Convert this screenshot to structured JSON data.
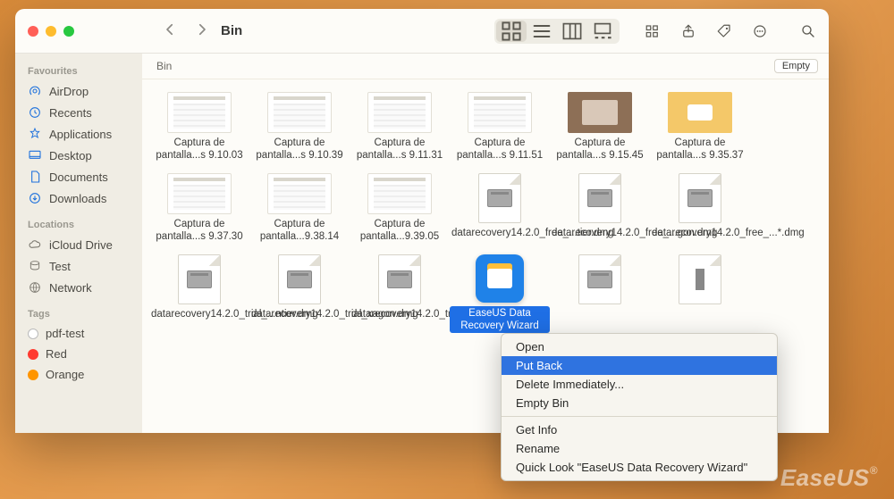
{
  "window": {
    "title": "Bin",
    "path_label": "Bin",
    "empty_button_label": "Empty"
  },
  "sidebar": {
    "favourites": {
      "heading": "Favourites",
      "items": [
        {
          "label": "AirDrop"
        },
        {
          "label": "Recents"
        },
        {
          "label": "Applications"
        },
        {
          "label": "Desktop"
        },
        {
          "label": "Documents"
        },
        {
          "label": "Downloads"
        }
      ]
    },
    "locations": {
      "heading": "Locations",
      "items": [
        {
          "label": "iCloud Drive"
        },
        {
          "label": "Test"
        },
        {
          "label": "Network"
        }
      ]
    },
    "tags": {
      "heading": "Tags",
      "items": [
        {
          "label": "pdf-test",
          "color": "#ffffff"
        },
        {
          "label": "Red",
          "color": "#ff3b30"
        },
        {
          "label": "Orange",
          "color": "#ff9500"
        }
      ]
    }
  },
  "files": {
    "row1": [
      {
        "name": "Captura de pantalla...s 9.10.03",
        "kind": "shot"
      },
      {
        "name": "Captura de pantalla...s 9.10.39",
        "kind": "shot"
      },
      {
        "name": "Captura de pantalla...s 9.11.31",
        "kind": "shot"
      },
      {
        "name": "Captura de pantalla...s 9.11.51",
        "kind": "shot"
      },
      {
        "name": "Captura de pantalla...s 9.15.45",
        "kind": "brown"
      },
      {
        "name": "Captura de pantalla...s 9.35.37",
        "kind": "yellow"
      }
    ],
    "row2": [
      {
        "name": "Captura de pantalla...s 9.37.30",
        "kind": "shot"
      },
      {
        "name": "Captura de pantalla...9.38.14",
        "kind": "shot"
      },
      {
        "name": "Captura de pantalla...9.39.05",
        "kind": "shot"
      },
      {
        "name": "datarecovery14.2.0_free_...tier.dmg",
        "kind": "dmg"
      },
      {
        "name": "datarecovery14.2.0_free_...gon.dmg",
        "kind": "dmg"
      },
      {
        "name": "datarecovery14.2.0_free_...*.dmg",
        "kind": "dmg"
      }
    ],
    "row3": [
      {
        "name": "datarecovery14.2.0_trial_...ntier.dmg",
        "kind": "dmg"
      },
      {
        "name": "datarecovery14.2.0_trial_xagon.dmg",
        "kind": "dmg"
      },
      {
        "name": "datarecovery14.2.0_trial_...*.dmg",
        "kind": "dmg"
      },
      {
        "name": "EaseUS Data Recovery Wizard",
        "kind": "app",
        "selected": true
      },
      {
        "name": "",
        "kind": "dmg"
      },
      {
        "name": "",
        "kind": "usb"
      }
    ]
  },
  "context_menu": {
    "items": [
      {
        "label": "Open"
      },
      {
        "label": "Put Back",
        "highlight": true
      },
      {
        "label": "Delete Immediately..."
      },
      {
        "label": "Empty Bin"
      },
      {
        "sep": true
      },
      {
        "label": "Get Info"
      },
      {
        "label": "Rename"
      },
      {
        "label": "Quick Look \"EaseUS Data Recovery Wizard\""
      }
    ]
  },
  "watermark": "EaseUS"
}
